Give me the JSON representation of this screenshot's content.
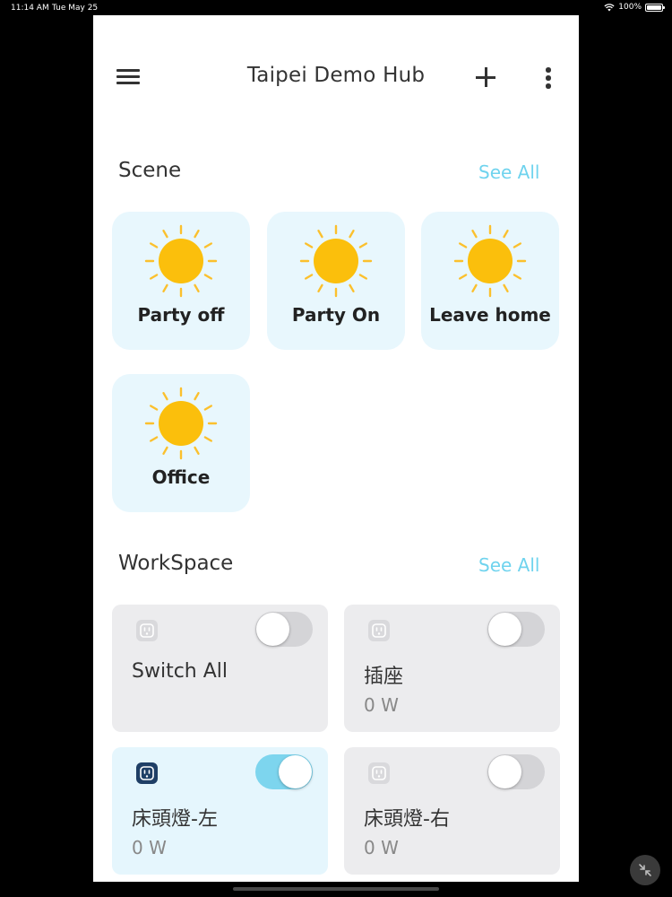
{
  "status_bar": {
    "time": "11:14 AM",
    "date": "Tue May 25",
    "battery": "100%",
    "icons": [
      "wifi-icon",
      "battery-icon"
    ]
  },
  "header": {
    "title": "Taipei Demo Hub",
    "icons": [
      "menu-icon",
      "plus-icon",
      "more-vertical-icon"
    ]
  },
  "scenes": {
    "title": "Scene",
    "see_all": "See All",
    "icon": "sun-icon",
    "items": [
      {
        "label": "Party off"
      },
      {
        "label": "Party On"
      },
      {
        "label": "Leave home"
      },
      {
        "label": "Office"
      }
    ]
  },
  "workspace": {
    "title": "WorkSpace",
    "see_all": "See All",
    "icon": "plug-icon",
    "items": [
      {
        "name": "Switch All",
        "power": "",
        "on": false
      },
      {
        "name": "插座",
        "power": "0 W",
        "on": false
      },
      {
        "name": "床頭燈-左",
        "power": "0 W",
        "on": true
      },
      {
        "name": "床頭燈-右",
        "power": "0 W",
        "on": false
      }
    ]
  },
  "colors": {
    "accent": "#6fd3ee",
    "scene_card": "#e8f7fd",
    "device_card": "#ececee",
    "device_card_active": "#e5f6fd",
    "sun": "#fbbf0c",
    "toggle_on": "#7dd5ee"
  }
}
